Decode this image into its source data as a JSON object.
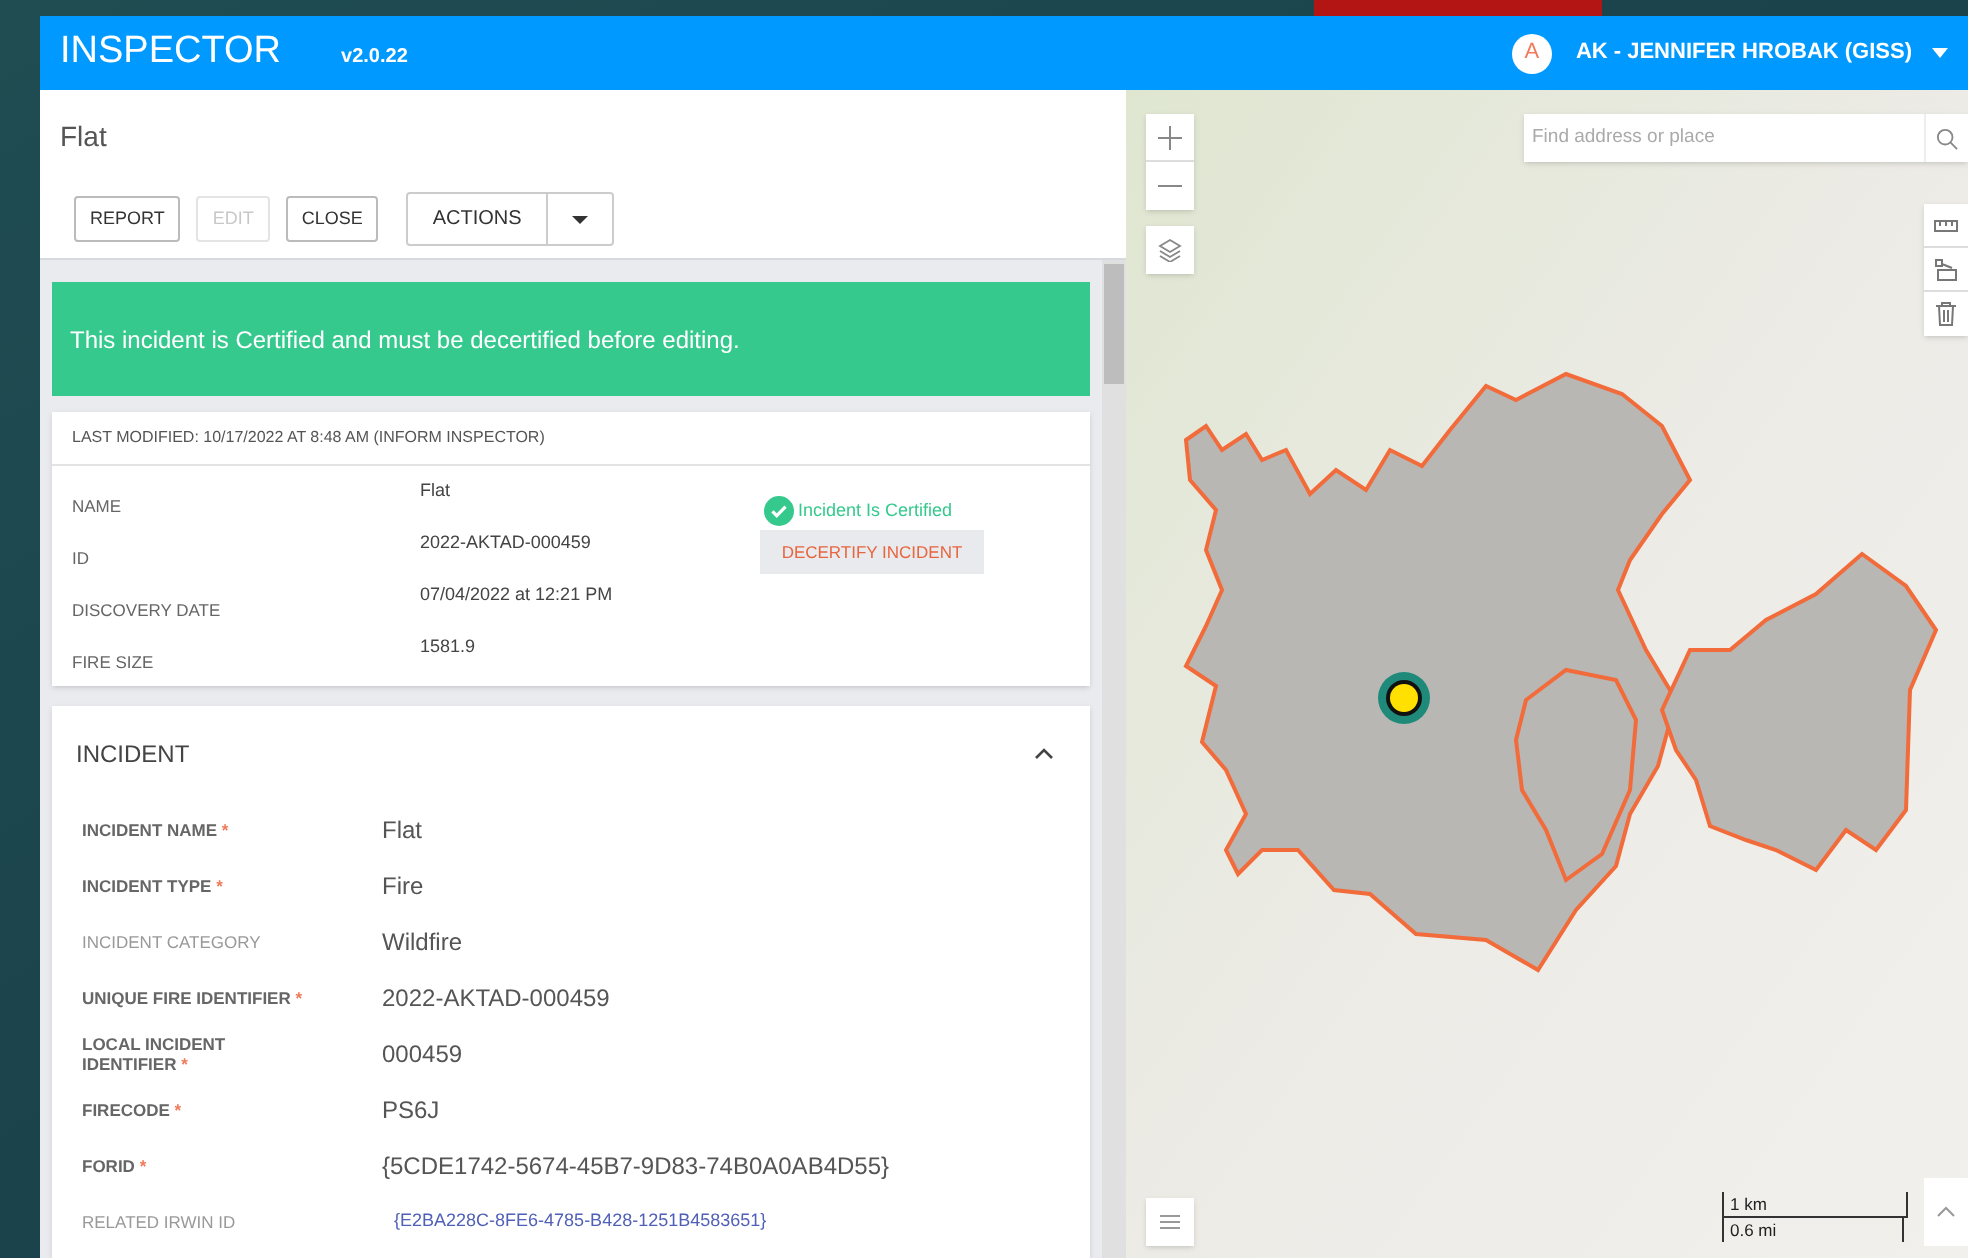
{
  "header": {
    "title": "INSPECTOR",
    "version": "v2.0.22",
    "avatar": "A",
    "user": "AK - JENNIFER HROBAK (GISS)"
  },
  "record": {
    "title": "Flat"
  },
  "buttons": [
    {
      "label": "REPORT",
      "disabled": false
    },
    {
      "label": "EDIT",
      "disabled": true
    },
    {
      "label": "CLOSE",
      "disabled": false
    }
  ],
  "actions": {
    "label": "ACTIONS"
  },
  "banner": "This incident is Certified and must be decertified before editing.",
  "summary": {
    "last_modified": "LAST MODIFIED: 10/17/2022 AT 8:48 AM (INFORM INSPECTOR)",
    "rows": [
      {
        "label": "NAME",
        "value": "Flat"
      },
      {
        "label": "ID",
        "value": "2022-AKTAD-000459"
      },
      {
        "label": "DISCOVERY DATE",
        "value": "07/04/2022 at 12:21 PM"
      },
      {
        "label": "FIRE SIZE",
        "value": "1581.9"
      }
    ],
    "status": "Incident Is Certified",
    "decertify": "DECERTIFY INCIDENT"
  },
  "incident": {
    "title": "INCIDENT",
    "expanded": true,
    "required_mark": "*",
    "fields": [
      {
        "label": "INCIDENT NAME",
        "required": true,
        "value": "Flat",
        "kind": "text"
      },
      {
        "label": "INCIDENT TYPE",
        "required": true,
        "value": "Fire",
        "kind": "text"
      },
      {
        "label": "INCIDENT CATEGORY",
        "required": false,
        "value": "Wildfire",
        "kind": "text"
      },
      {
        "label": "UNIQUE FIRE IDENTIFIER",
        "required": true,
        "value": "2022-AKTAD-000459",
        "kind": "text"
      },
      {
        "label": "LOCAL INCIDENT IDENTIFIER",
        "required": true,
        "value": "000459",
        "kind": "text"
      },
      {
        "label": "FIRECODE",
        "required": true,
        "value": "PS6J",
        "kind": "text"
      },
      {
        "label": "FORID",
        "required": true,
        "value": "{5CDE1742-5674-45B7-9D83-74B0A0AB4D55}",
        "kind": "text"
      },
      {
        "label": "RELATED IRWIN ID",
        "required": false,
        "value": "{E2BA228C-8FE6-4785-B428-1251B4583651}",
        "kind": "link"
      }
    ]
  },
  "map": {
    "search_placeholder": "Find address or place",
    "scale_km": "1 km",
    "scale_mi": "0.6 mi"
  }
}
